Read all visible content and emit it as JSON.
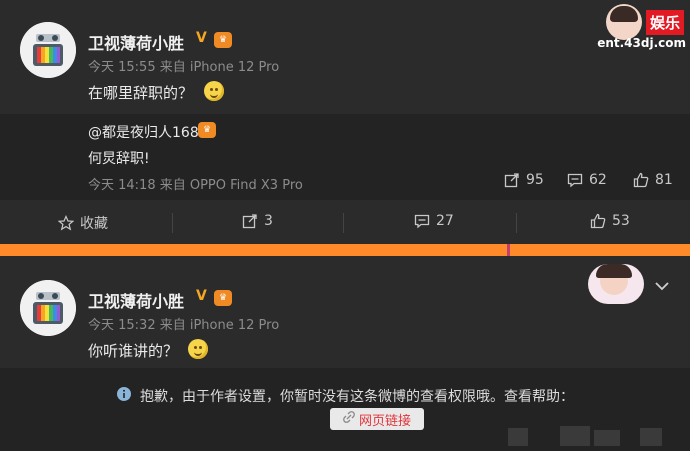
{
  "post1": {
    "author": "卫视薄荷小胜",
    "meta": "今天 15:55 来自 iPhone 12 Pro",
    "text": "在哪里辞职的？"
  },
  "repost": {
    "author": "@都是夜归人168",
    "text": "何炅辞职!",
    "meta": "今天 14:18 来自 OPPO Find X3 Pro",
    "shares": "95",
    "comments": "62",
    "likes": "81"
  },
  "toolbar": {
    "favorite_label": "收藏",
    "share_count": "3",
    "comment_count": "27",
    "like_count": "53"
  },
  "post2": {
    "author": "卫视薄荷小胜",
    "meta": "今天 15:32 来自 iPhone 12 Pro",
    "text": "你听谁讲的？"
  },
  "notice": {
    "text": "抱歉，由于作者设置，你暂时没有这条微博的查看权限哦。查看帮助：",
    "link_label": "网页链接"
  },
  "watermark": {
    "label": "娱乐",
    "url": "ent.43dj.com"
  },
  "colors": {
    "background": "#2b2b2b",
    "repost_bg": "#232323",
    "accent_orange": "#ff8a2a",
    "verified": "#f5a623",
    "link_red": "#e2353b"
  }
}
